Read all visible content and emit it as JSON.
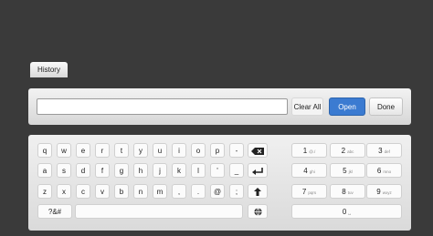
{
  "history_tab": {
    "label": "History"
  },
  "input_bar": {
    "value": "",
    "clear_label": "Clear All",
    "open_label": "Open",
    "done_label": "Done"
  },
  "keyboard": {
    "rows": [
      [
        "q",
        "w",
        "e",
        "r",
        "t",
        "y",
        "u",
        "i",
        "o",
        "p",
        "-"
      ],
      [
        "a",
        "s",
        "d",
        "f",
        "g",
        "h",
        "j",
        "k",
        "l",
        "'",
        "_"
      ],
      [
        "z",
        "x",
        "c",
        "v",
        "b",
        "n",
        "m",
        ",",
        ".",
        "@",
        ";"
      ]
    ],
    "mode_label": "?&#",
    "special_icons": [
      "backspace-icon",
      "enter-icon",
      "shift-icon",
      "globe-icon"
    ],
    "numpad": [
      [
        {
          "digit": "1",
          "letters": "@./"
        },
        {
          "digit": "2",
          "letters": "abc"
        },
        {
          "digit": "3",
          "letters": "def"
        }
      ],
      [
        {
          "digit": "4",
          "letters": "ghi"
        },
        {
          "digit": "5",
          "letters": "jkl"
        },
        {
          "digit": "6",
          "letters": "mno"
        }
      ],
      [
        {
          "digit": "7",
          "letters": "pqrs"
        },
        {
          "digit": "8",
          "letters": "tuv"
        },
        {
          "digit": "9",
          "letters": "wxyz"
        }
      ]
    ],
    "zero_key": {
      "digit": "0",
      "letters": "␣"
    }
  }
}
